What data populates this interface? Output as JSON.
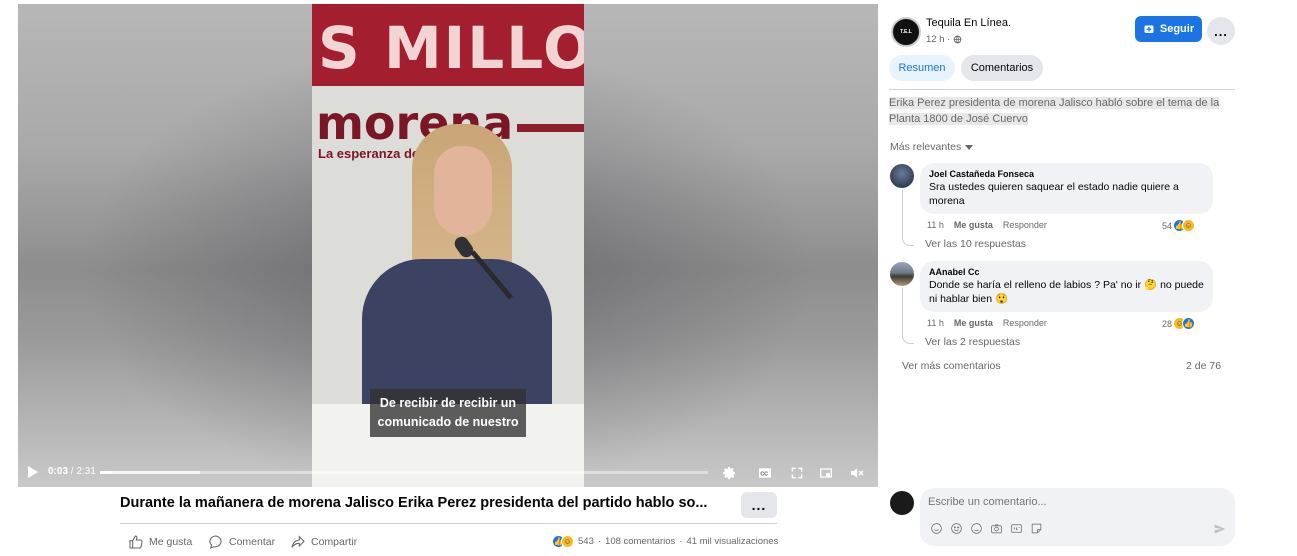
{
  "video": {
    "banner_text": "S MILLO",
    "logo_text": "morena",
    "logo_tagline": "La esperanza de",
    "subtitle_line1": "De recibir de recibir un",
    "subtitle_line2": "comunicado de nuestro",
    "current_time": "0:03",
    "duration": "2:31",
    "progress_fraction": 0.0199
  },
  "post": {
    "title": "Durante la mañanera de morena Jalisco Erika Perez presidenta del partido hablo so...",
    "more_label": "...",
    "actions": {
      "like": "Me gusta",
      "comment": "Comentar",
      "share": "Compartir"
    },
    "stats": {
      "reactions": "543",
      "comments": "108 comentarios",
      "separator": "·",
      "views": "41 mil visualizaciones"
    }
  },
  "panel": {
    "page_name": "Tequila En Línea.",
    "page_avatar_text": "T.E.L",
    "post_time": "12 h ·",
    "follow_label": "Seguir",
    "more_label": "...",
    "tabs": [
      {
        "label": "Resumen",
        "active": true
      },
      {
        "label": "Comentarios",
        "active": false
      }
    ],
    "description": "Erika Perez presidenta de morena Jalisco habló sobre el tema de la Planta 1800 de José Cuervo",
    "sort_label": "Más relevantes",
    "comments": [
      {
        "author": "Joel Castañeda Fonseca",
        "text": "Sra ustedes quieren saquear el estado nadie quiere a morena",
        "time": "11 h",
        "like_label": "Me gusta",
        "reply_label": "Responder",
        "reaction_count": "54",
        "replies_label": "Ver las 10 respuestas"
      },
      {
        "author": "AAnabel Cc",
        "text_part1": "Donde se haría el relleno de labios ? Pa' no ir",
        "text_part2": "no puede ni hablar bien",
        "time": "11 h",
        "like_label": "Me gusta",
        "reply_label": "Responder",
        "reaction_count": "28",
        "replies_label": "Ver las 2 respuestas"
      }
    ],
    "more_comments_label": "Ver más comentarios",
    "comment_count": "2 de 76",
    "composer_placeholder": "Escribe un comentario..."
  },
  "colors": {
    "accent": "#1b74e4",
    "banner": "#a31f2f"
  }
}
